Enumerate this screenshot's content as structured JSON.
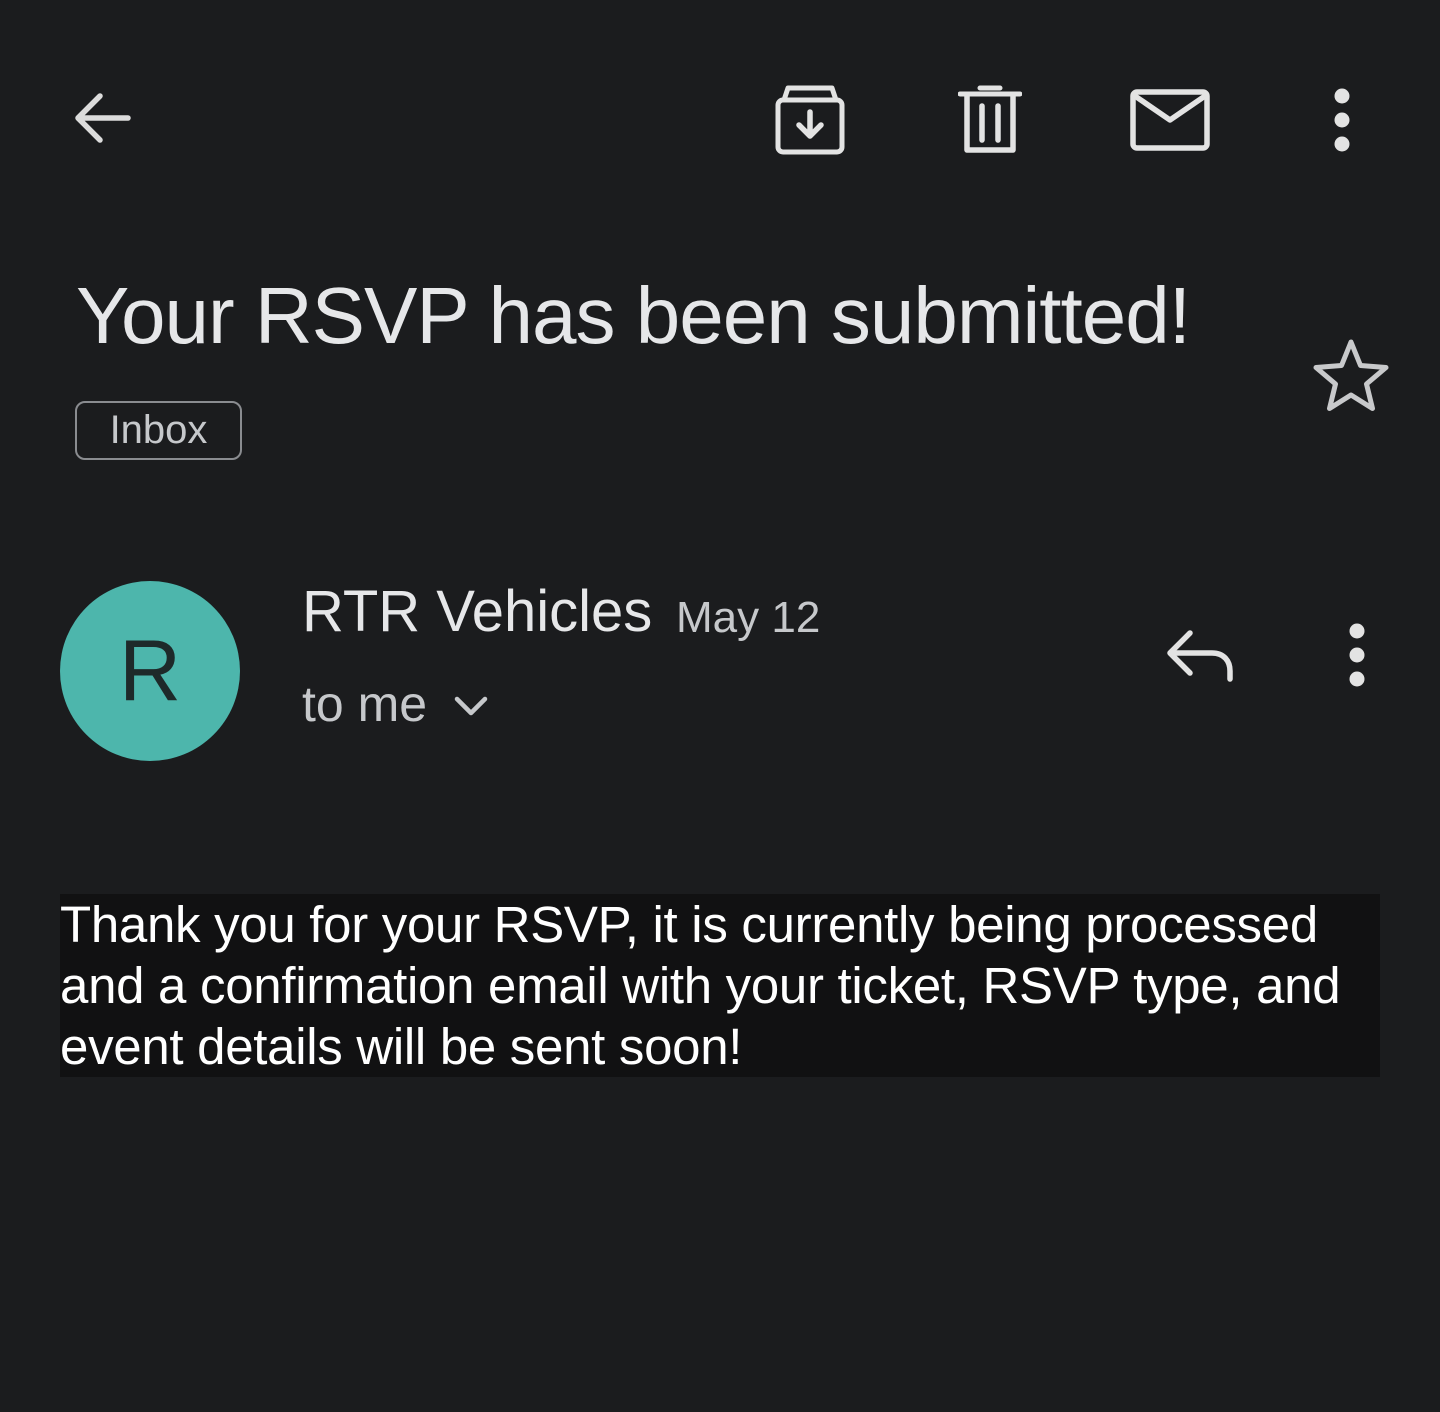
{
  "toolbar": {
    "icons": {
      "back": "arrow-back-icon",
      "archive": "archive-icon",
      "delete": "trash-icon",
      "mark_unread": "mail-icon",
      "more": "more-vert-icon"
    }
  },
  "email": {
    "subject": "Your RSVP has been submitted!",
    "label": "Inbox",
    "sender": {
      "avatar_initial": "R",
      "avatar_color": "#4db6ac",
      "name": "RTR Vehicles",
      "date": "May 12",
      "recipient": "to me"
    },
    "body": "Thank you for your RSVP, it is currently being processed and a confirmation email with your ticket, RSVP type, and event details will be sent soon!"
  },
  "colors": {
    "background": "#1b1c1e",
    "body_background": "#111112",
    "text_primary": "#e6e7e9",
    "icon": "#e3e3e3"
  }
}
